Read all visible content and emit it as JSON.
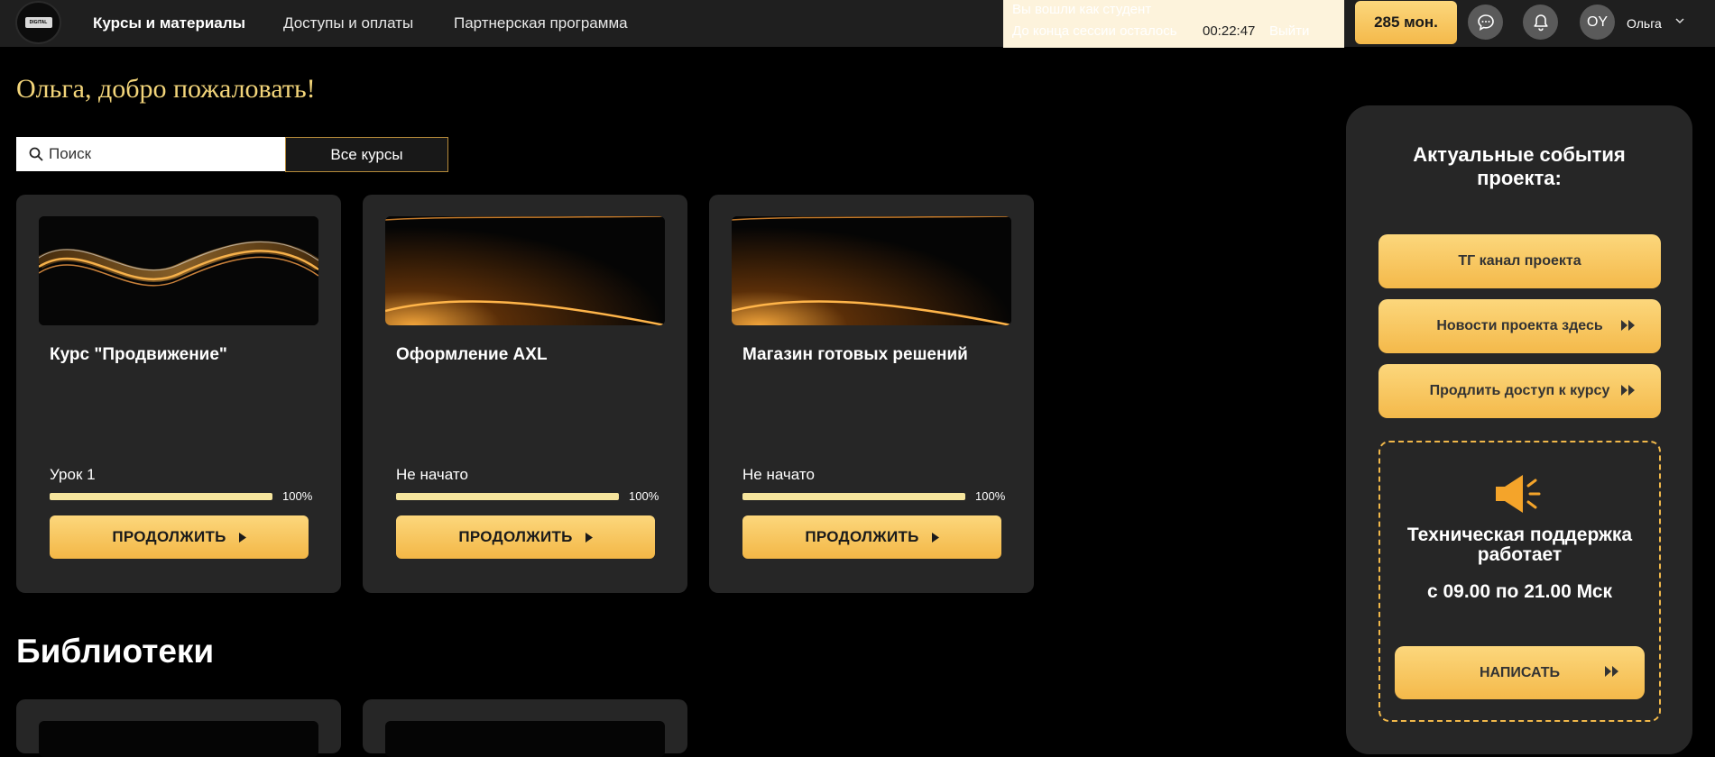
{
  "brand": {
    "logo_text": "DIGITAL"
  },
  "nav": {
    "items": [
      {
        "label": "Курсы и материалы",
        "active": true
      },
      {
        "label": "Доступы и оплаты",
        "active": false
      },
      {
        "label": "Партнерская программа",
        "active": false
      }
    ]
  },
  "banner": {
    "line1": "Вы вошли как студент",
    "line2": "До конца сессии осталось",
    "timer": "00:22:47",
    "link": "Выйти"
  },
  "header": {
    "coins": "285 мон.",
    "avatar_initials": "OY",
    "username": "Ольга"
  },
  "welcome": "Ольга, добро пожаловать!",
  "search": {
    "placeholder": "Поиск"
  },
  "filter": {
    "selected": "Все курсы"
  },
  "courses": [
    {
      "title": "Курс \"Продвижение\"",
      "status": "Урок 1",
      "progress": 100,
      "progress_label": "100%",
      "button": "ПРОДОЛЖИТЬ"
    },
    {
      "title": "Оформление AXL",
      "status": "Не начато",
      "progress": 100,
      "progress_label": "100%",
      "button": "ПРОДОЛЖИТЬ"
    },
    {
      "title": "Магазин готовых решений",
      "status": "Не начато",
      "progress": 100,
      "progress_label": "100%",
      "button": "ПРОДОЛЖИТЬ"
    }
  ],
  "libraries": {
    "title": "Библиотеки"
  },
  "sidebar": {
    "title": "Актуальные события проекта:",
    "buttons": [
      {
        "label": "ТГ канал проекта"
      },
      {
        "label": "Новости проекта здесь"
      },
      {
        "label": "Продлить доступ к курсу"
      }
    ],
    "support": {
      "title": "Техническая поддержка работает",
      "hours": "с 09.00 по 21.00 Мск",
      "button": "НАПИСАТЬ"
    }
  },
  "colors": {
    "accent": "#f4b94a",
    "accent_light": "#fcd77c",
    "welcome": "#f3d57a",
    "progress": "#f6e59d"
  }
}
